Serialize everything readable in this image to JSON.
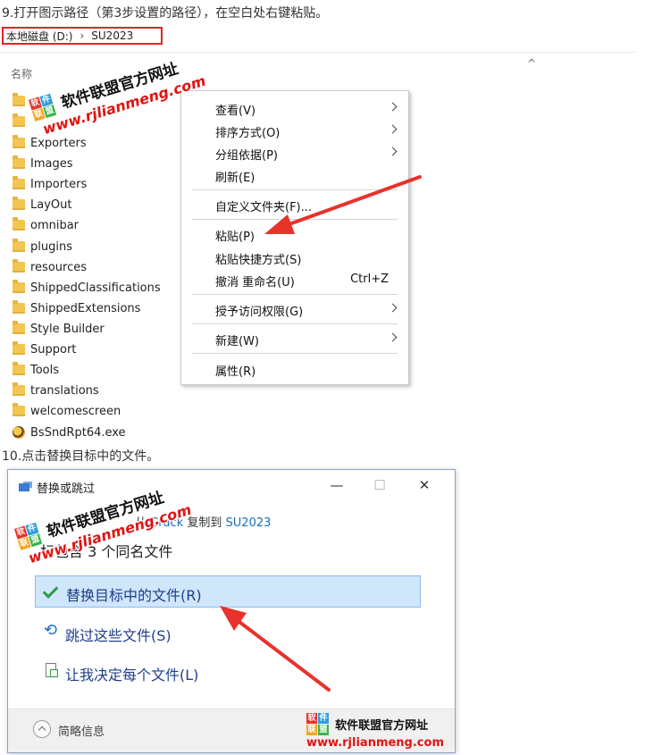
{
  "step9_caption": "9.打开图示路径（第3步设置的路径），在空白处右键粘贴。",
  "breadcrumb": {
    "drive": "本地磁盘 (D:)",
    "folder": "SU2023"
  },
  "explorer": {
    "column_name": "名称",
    "files": [
      {
        "name": "",
        "type": "folder"
      },
      {
        "name": "",
        "type": "folder"
      },
      {
        "name": "Exporters",
        "type": "folder"
      },
      {
        "name": "Images",
        "type": "folder"
      },
      {
        "name": "Importers",
        "type": "folder"
      },
      {
        "name": "LayOut",
        "type": "folder"
      },
      {
        "name": "omnibar",
        "type": "folder"
      },
      {
        "name": "plugins",
        "type": "folder"
      },
      {
        "name": "resources",
        "type": "folder"
      },
      {
        "name": "ShippedClassifications",
        "type": "folder"
      },
      {
        "name": "ShippedExtensions",
        "type": "folder"
      },
      {
        "name": "Style Builder",
        "type": "folder"
      },
      {
        "name": "Support",
        "type": "folder"
      },
      {
        "name": "Tools",
        "type": "folder"
      },
      {
        "name": "translations",
        "type": "folder"
      },
      {
        "name": "welcomescreen",
        "type": "folder"
      },
      {
        "name": "BsSndRpt64.exe",
        "type": "exe"
      }
    ]
  },
  "context_menu": {
    "items": [
      {
        "label": "查看(V)",
        "submenu": true
      },
      {
        "label": "排序方式(O)",
        "submenu": true
      },
      {
        "label": "分组依据(P)",
        "submenu": true
      },
      {
        "label": "刷新(E)"
      },
      {
        "label": "自定义文件夹(F)..."
      },
      {
        "label": "粘贴(P)"
      },
      {
        "label": "粘贴快捷方式(S)"
      },
      {
        "label": "撤消 重命名(U)",
        "shortcut": "Ctrl+Z"
      },
      {
        "label": "授予访问权限(G)",
        "submenu": true
      },
      {
        "label": "新建(W)",
        "submenu": true
      },
      {
        "label": "属性(R)"
      }
    ]
  },
  "step10_caption": "10.点击替换目标中的文件。",
  "dialog": {
    "title": "替换或跳过",
    "from_prefix": "从",
    "source": "Crack",
    "copy_to": "复制到",
    "dest": "SU2023",
    "summary": "标包含 3 个同名文件",
    "options": {
      "replace": "替换目标中的文件(R)",
      "skip": "跳过这些文件(S)",
      "decide": "让我决定每个文件(L)"
    },
    "details": "简略信息",
    "minimize_glyph": "—",
    "maximize_glyph": "☐",
    "close_glyph": "✕"
  },
  "watermark": {
    "logo_chars": [
      "软",
      "件",
      "联",
      "盟"
    ],
    "logo_colors": [
      "#e8322b",
      "#2f9de0",
      "#f5a623",
      "#3cb44b"
    ],
    "name": "软件联盟官方网址",
    "url": "www.rjlianmeng.com"
  },
  "colors": {
    "arrow": "#e8322b",
    "highlight_border": "#e02424",
    "selection": "#cfe6fb",
    "link": "#1a6fb8"
  }
}
